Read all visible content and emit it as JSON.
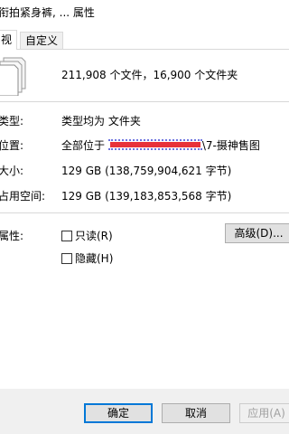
{
  "window": {
    "title": "衔拍紧身裤, ... 属性"
  },
  "tabs": [
    {
      "label": "视",
      "active": true
    },
    {
      "label": "自定义",
      "active": false
    }
  ],
  "summary": {
    "text": "211,908 个文件，16,900 个文件夹"
  },
  "properties": {
    "type_label": "类型:",
    "type_value": "类型均为 文件夹",
    "location_label": "位置:",
    "location_prefix": "全部位于",
    "location_suffix": "\\7-摄神售图",
    "size_label": "大小:",
    "size_value": "129 GB (138,759,904,621 字节)",
    "disk_label": "占用空间:",
    "disk_value": "129 GB (139,183,853,568 字节)"
  },
  "attributes": {
    "label": "属性:",
    "readonly_label": "只读(R)",
    "hidden_label": "隐藏(H)",
    "readonly_checked": false,
    "hidden_checked": false,
    "advanced_label": "高级(D)..."
  },
  "buttons": {
    "ok": "确定",
    "cancel": "取消",
    "apply": "应用(A)"
  },
  "colors": {
    "accent": "#0078d7",
    "redaction": "#e8323a"
  }
}
